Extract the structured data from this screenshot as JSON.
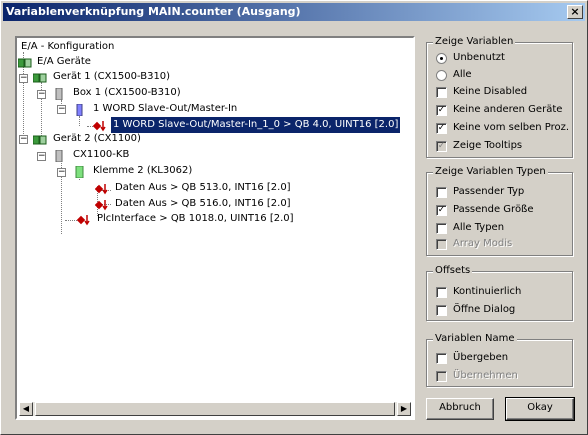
{
  "window": {
    "title": "Variablenverknüpfung MAIN.counter (Ausgang)",
    "close_glyph": "×"
  },
  "tree": {
    "items": [
      {
        "label": "E/A - Konfiguration"
      },
      {
        "label": "E/A Geräte"
      },
      {
        "label": "Gerät 1 (CX1500-B310)"
      },
      {
        "label": "Box 1 (CX1500-B310)"
      },
      {
        "label": "1 WORD Slave-Out/Master-In"
      },
      {
        "label": "1 WORD Slave-Out/Master-In_1_0    >    QB 4.0, UINT16 [2.0]"
      },
      {
        "label": "Gerät 2 (CX1100)"
      },
      {
        "label": "CX1100-KB"
      },
      {
        "label": "Klemme 2 (KL3062)"
      },
      {
        "label": "Daten Aus    >    QB 513.0, INT16 [2.0]"
      },
      {
        "label": "Daten Aus    >    QB 516.0, INT16 [2.0]"
      },
      {
        "label": "PlcInterface    >    QB 1018.0, UINT16 [2.0]"
      }
    ]
  },
  "groups": {
    "show_vars": {
      "title": "Zeige Variablen",
      "options": [
        {
          "label": "Unbenutzt",
          "kind": "radio",
          "checked": true
        },
        {
          "label": "Alle",
          "kind": "radio",
          "checked": false
        },
        {
          "label": "Keine Disabled",
          "kind": "check",
          "checked": false
        },
        {
          "label": "Keine anderen Geräte",
          "kind": "check",
          "checked": true
        },
        {
          "label": "Keine vom selben Proz.",
          "kind": "check",
          "checked": true
        },
        {
          "label": "Zeige Tooltips",
          "kind": "check",
          "checked": true,
          "disabled": true
        }
      ]
    },
    "var_types": {
      "title": "Zeige Variablen Typen",
      "options": [
        {
          "label": "Passender Typ",
          "checked": false
        },
        {
          "label": "Passende Größe",
          "checked": true
        },
        {
          "label": "Alle Typen",
          "checked": false
        },
        {
          "label": "Array Modis",
          "checked": false,
          "disabled": true
        }
      ]
    },
    "offsets": {
      "title": "Offsets",
      "options": [
        {
          "label": "Kontinuierlich",
          "checked": false
        },
        {
          "label": "Öffne Dialog",
          "checked": false
        }
      ]
    },
    "var_name": {
      "title": "Variablen Name",
      "options": [
        {
          "label": "Übergeben",
          "checked": false
        },
        {
          "label": "Übernehmen",
          "checked": false,
          "disabled": true
        }
      ]
    }
  },
  "buttons": {
    "cancel": "Abbruch",
    "ok": "Okay"
  },
  "check_glyph": "✓",
  "icons": {
    "expander_minus": "−",
    "scroll_left": "◀",
    "scroll_right": "▶"
  }
}
